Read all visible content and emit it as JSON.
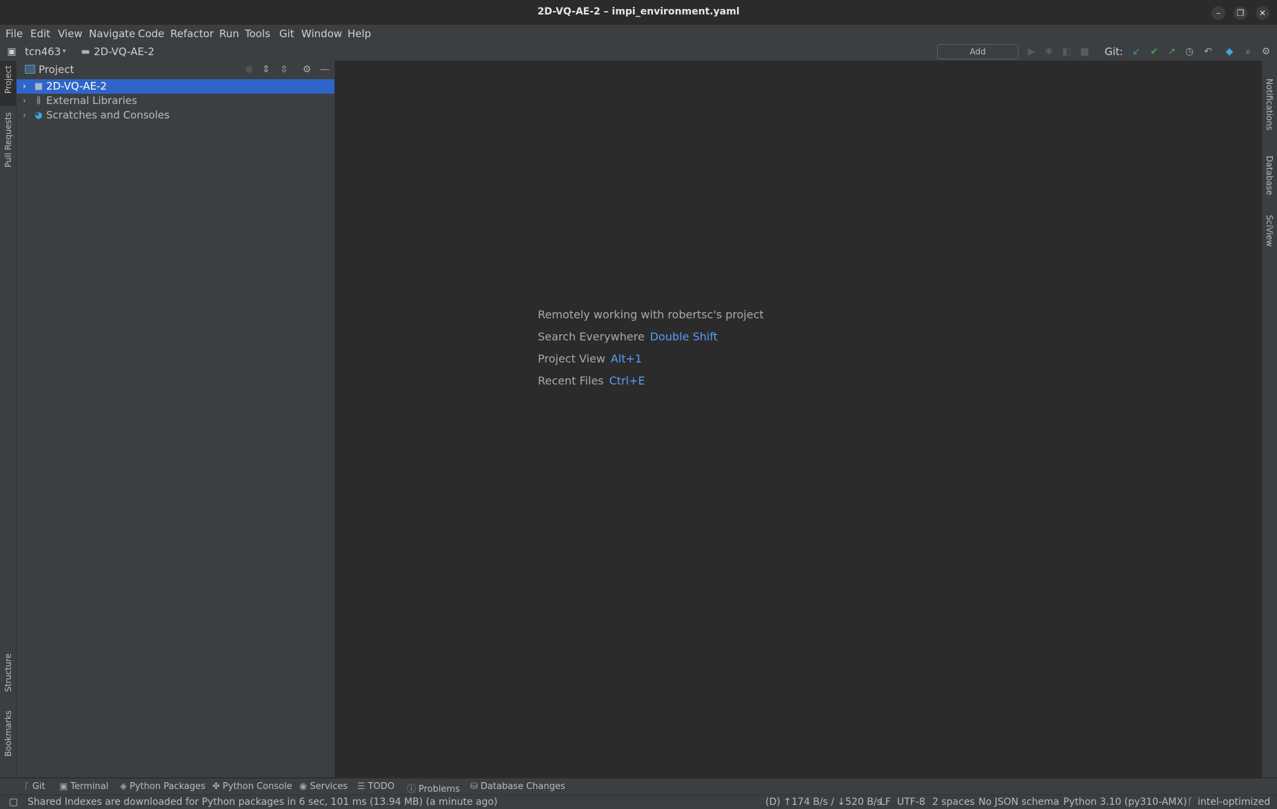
{
  "window": {
    "title": "2D-VQ-AE-2 – impi_environment.yaml"
  },
  "menu": [
    "File",
    "Edit",
    "View",
    "Navigate",
    "Code",
    "Refactor",
    "Run",
    "Tools",
    "Git",
    "Window",
    "Help"
  ],
  "nav": {
    "host": "tcn463",
    "project": "2D-VQ-AE-2",
    "add_config": "Add Configuration...",
    "git_label": "Git:"
  },
  "left_strip": {
    "project": "Project",
    "pull_requests": "Pull Requests",
    "structure": "Structure",
    "bookmarks": "Bookmarks"
  },
  "right_strip": {
    "notifications": "Notifications",
    "database": "Database",
    "sciview": "SciView"
  },
  "project_panel": {
    "title": "Project",
    "tree": [
      {
        "label": "2D-VQ-AE-2",
        "icon": "folder-icon",
        "selected": true
      },
      {
        "label": "External Libraries",
        "icon": "library-icon",
        "selected": false
      },
      {
        "label": "Scratches and Consoles",
        "icon": "scratches-icon",
        "selected": false
      }
    ]
  },
  "editor": {
    "remote": "Remotely working with robertsc's project",
    "hints": [
      {
        "label": "Search Everywhere",
        "key": "Double Shift"
      },
      {
        "label": "Project View",
        "key": "Alt+1"
      },
      {
        "label": "Recent Files",
        "key": "Ctrl+E"
      }
    ]
  },
  "tool_windows": [
    "Git",
    "Terminal",
    "Python Packages",
    "Python Console",
    "Services",
    "TODO",
    "Problems",
    "Database Changes"
  ],
  "status": {
    "message": "Shared Indexes are downloaded for Python packages in 6 sec, 101 ms (13.94 MB) (a minute ago)",
    "traffic": "(D) ↑174 B/s / ↓520 B/s",
    "line_sep": "LF",
    "encoding": "UTF-8",
    "indent": "2 spaces",
    "schema": "No JSON schema",
    "interpreter": "Python 3.10 (py310-AMX)",
    "branch": "intel-optimized"
  },
  "colors": {
    "accent": "#2f65ca",
    "link": "#589df6",
    "bg": "#2b2b2b",
    "panel": "#3c3f41"
  }
}
